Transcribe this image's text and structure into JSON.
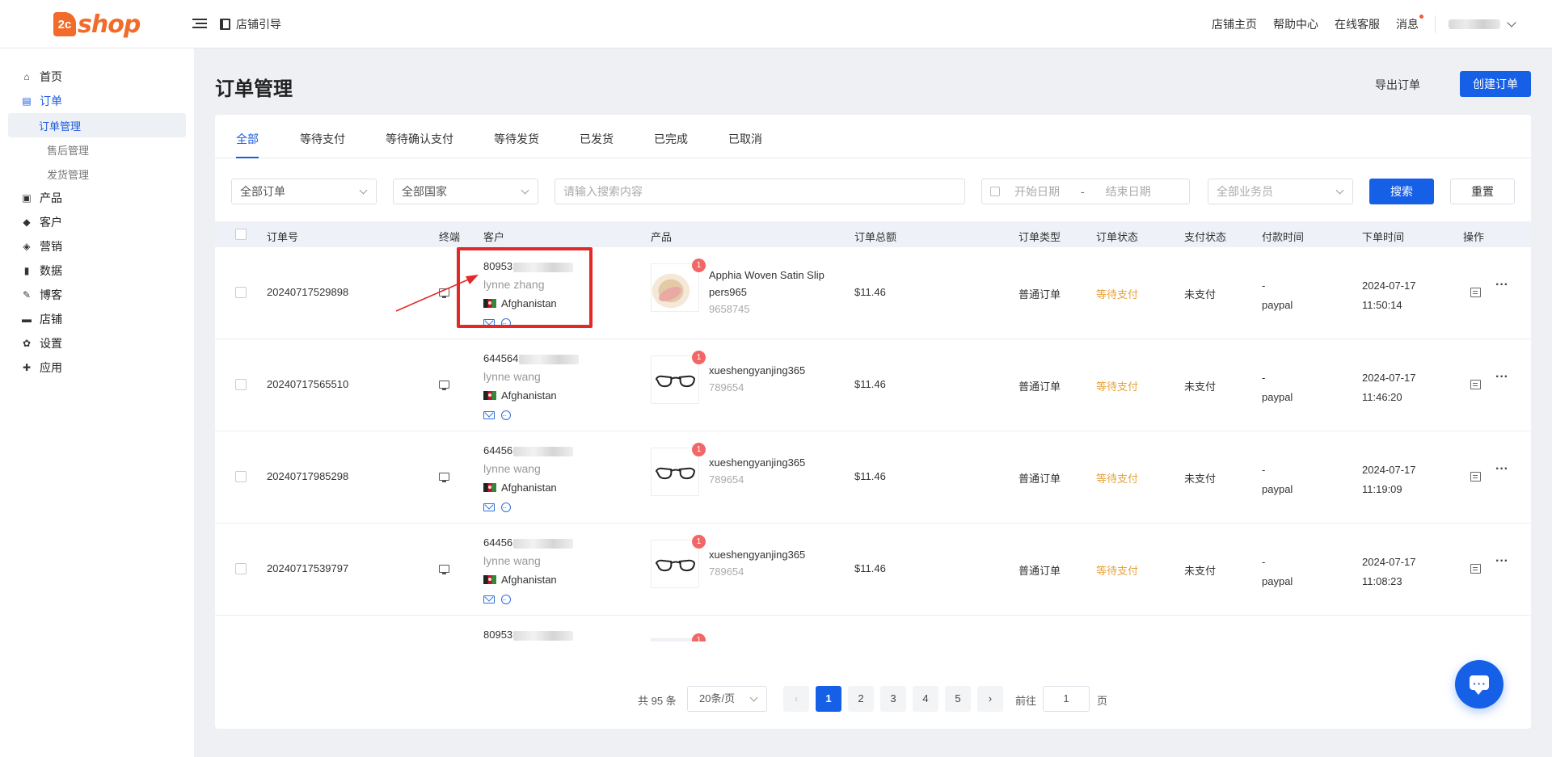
{
  "topbar": {
    "logo_mark": "2c",
    "logo_text": "shop",
    "guide_label": "店铺引导",
    "links": [
      "店铺主页",
      "帮助中心",
      "在线客服",
      "消息"
    ]
  },
  "sidebar": {
    "items": [
      {
        "label": "首页",
        "icon": "home-icon"
      },
      {
        "label": "订单",
        "icon": "order-icon"
      },
      {
        "label": "产品",
        "icon": "product-icon"
      },
      {
        "label": "客户",
        "icon": "customer-icon"
      },
      {
        "label": "营销",
        "icon": "tag-icon"
      },
      {
        "label": "数据",
        "icon": "chart-icon"
      },
      {
        "label": "博客",
        "icon": "blog-icon"
      },
      {
        "label": "店铺",
        "icon": "store-icon"
      },
      {
        "label": "设置",
        "icon": "gear-icon"
      },
      {
        "label": "应用",
        "icon": "puzzle-icon"
      }
    ],
    "order_subitems": [
      "订单管理",
      "售后管理",
      "发货管理"
    ]
  },
  "page": {
    "title": "订单管理",
    "export_label": "导出订单",
    "create_label": "创建订单"
  },
  "tabs": [
    "全部",
    "等待支付",
    "等待确认支付",
    "等待发货",
    "已发货",
    "已完成",
    "已取消"
  ],
  "filters": {
    "order_type": "全部订单",
    "country": "全部国家",
    "search_placeholder": "请输入搜索内容",
    "start_date": "开始日期",
    "date_sep": "-",
    "end_date": "结束日期",
    "salesperson": "全部业务员",
    "search_label": "搜索",
    "reset_label": "重置"
  },
  "table": {
    "headers": [
      "订单号",
      "终端",
      "客户",
      "产品",
      "订单总额",
      "订单类型",
      "订单状态",
      "支付状态",
      "付款时间",
      "下单时间",
      "操作"
    ],
    "rows": [
      {
        "order_no": "20240717529898",
        "cust_id": "80953",
        "cust_name": "lynne zhang",
        "country": "Afghanistan",
        "prod_name_1": "Apphia Woven Satin Slip",
        "prod_name_2": "pers965",
        "sku": "9658745",
        "badge": "1",
        "total": "$11.46",
        "type": "普通订单",
        "status": "等待支付",
        "pay_status": "未支付",
        "pay_time": "-",
        "pay_method": "paypal",
        "date": "2024-07-17",
        "time": "11:50:14"
      },
      {
        "order_no": "20240717565510",
        "cust_id": "644564",
        "cust_name": "lynne wang",
        "country": "Afghanistan",
        "prod_name_1": "xueshengyanjing365",
        "prod_name_2": "",
        "sku": "789654",
        "badge": "1",
        "total": "$11.46",
        "type": "普通订单",
        "status": "等待支付",
        "pay_status": "未支付",
        "pay_time": "-",
        "pay_method": "paypal",
        "date": "2024-07-17",
        "time": "11:46:20"
      },
      {
        "order_no": "20240717985298",
        "cust_id": "64456",
        "cust_name": "lynne wang",
        "country": "Afghanistan",
        "prod_name_1": "xueshengyanjing365",
        "prod_name_2": "",
        "sku": "789654",
        "badge": "1",
        "total": "$11.46",
        "type": "普通订单",
        "status": "等待支付",
        "pay_status": "未支付",
        "pay_time": "-",
        "pay_method": "paypal",
        "date": "2024-07-17",
        "time": "11:19:09"
      },
      {
        "order_no": "20240717539797",
        "cust_id": "64456",
        "cust_name": "lynne wang",
        "country": "Afghanistan",
        "prod_name_1": "xueshengyanjing365",
        "prod_name_2": "",
        "sku": "789654",
        "badge": "1",
        "total": "$11.46",
        "type": "普通订单",
        "status": "等待支付",
        "pay_status": "未支付",
        "pay_time": "-",
        "pay_method": "paypal",
        "date": "2024-07-17",
        "time": "11:08:23"
      },
      {
        "order_no": "",
        "cust_id": "80953",
        "cust_name": "",
        "country": "",
        "prod_name_1": "",
        "prod_name_2": "",
        "sku": "",
        "badge": "1",
        "total": "",
        "type": "",
        "status": "",
        "pay_status": "",
        "pay_time": "",
        "pay_method": "",
        "date": "",
        "time": ""
      }
    ]
  },
  "pagination": {
    "total": "共 95 条",
    "page_size": "20条/页",
    "prev": "‹",
    "pages": [
      "1",
      "2",
      "3",
      "4",
      "5"
    ],
    "next": "›",
    "goto_label": "前往",
    "goto_value": "1",
    "goto_unit": "页"
  }
}
